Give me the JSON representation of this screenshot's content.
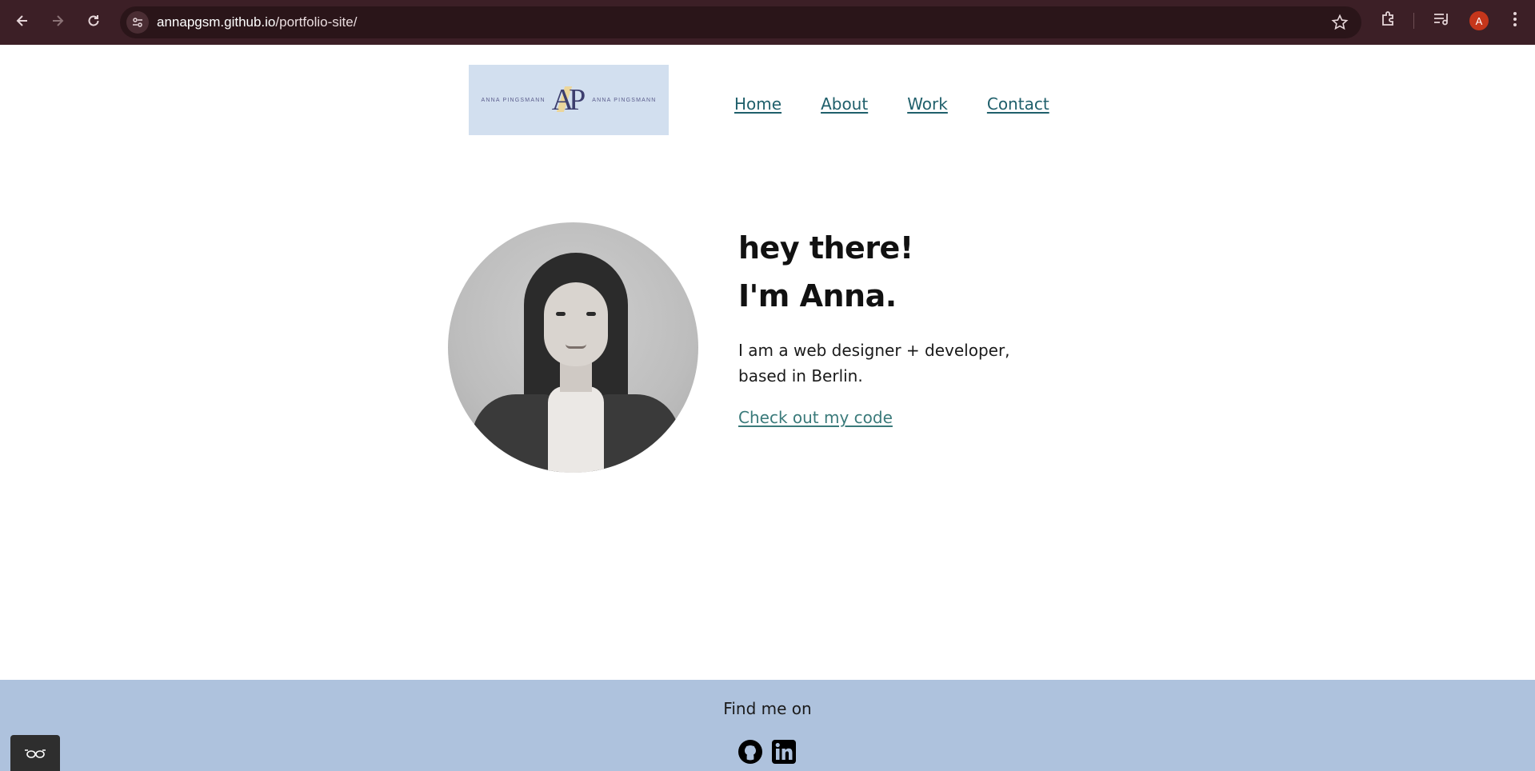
{
  "browser": {
    "url_host": "annapgsm.github.io",
    "url_path": "/portfolio-site/",
    "profile_initial": "A",
    "accent_color": "#3c1f26"
  },
  "logo": {
    "left_text": "ANNA PINGSMANN",
    "mark_a": "A",
    "mark_p": "P",
    "right_text": "ANNA PINGSMANN",
    "bg_color": "#d2dfef"
  },
  "nav": {
    "items": [
      {
        "label": "Home"
      },
      {
        "label": "About"
      },
      {
        "label": "Work"
      },
      {
        "label": "Contact"
      }
    ],
    "link_color": "#1f5f6b"
  },
  "hero": {
    "line1": "hey there!",
    "line2": "I'm Anna.",
    "intro_line1": "I am a web designer + developer,",
    "intro_line2": "based in Berlin.",
    "cta": "Check out my code"
  },
  "footer": {
    "heading": "Find me on",
    "icons": [
      "github-icon",
      "linkedin-icon"
    ],
    "bg_color": "#aec2dd"
  },
  "widget": {
    "icon": "glasses-icon"
  }
}
